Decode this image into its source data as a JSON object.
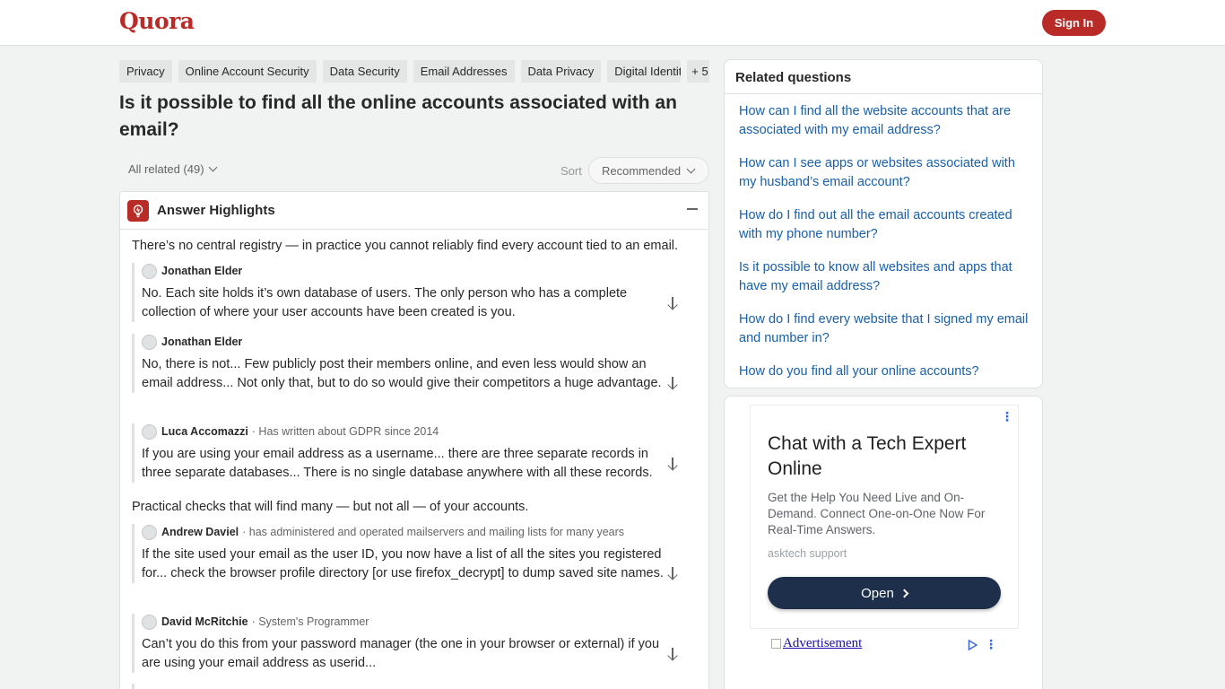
{
  "header": {
    "logo": "Quora",
    "sign_in": "Sign In"
  },
  "tags": [
    "Privacy",
    "Online Account Security",
    "Data Security",
    "Email Addresses",
    "Data Privacy",
    "Digital Identit",
    "+ 5"
  ],
  "question": {
    "title": "Is it possible to find all the online accounts associated with an email?"
  },
  "filters": {
    "all_related": "All related (49)",
    "sort_label": "Sort",
    "sort_value": "Recommended"
  },
  "highlights": {
    "title": "Answer Highlights",
    "sections": [
      {
        "summary": "There’s no central registry — in practice you cannot reliably find every account tied to an email.",
        "quotes": [
          {
            "author": "Jonathan Elder",
            "credential": "",
            "text": "No. Each site holds it’s own database of users. The only person who has a complete collection of where your user accounts have been created is you."
          },
          {
            "author": "Jonathan Elder",
            "credential": "",
            "text": "No, there is not... Few publicly post their members online, and even less would show an email address... Not only that, but to do so would give their competitors a huge advantage."
          },
          {
            "author": "Luca Accomazzi",
            "credential": "· Has written about GDPR since 2014",
            "text": "If you are using your email address as a username... there are three separate records in three separate databases... There is no single database anywhere with all these records."
          }
        ]
      },
      {
        "summary": "Practical checks that will find many — but not all — of your accounts.",
        "quotes": [
          {
            "author": "Andrew Daviel",
            "credential": "· has administered and operated mailservers and mailing lists for many years",
            "text": "If the site used your email as the user ID, you now have a list of all the sites you registered for... check the browser profile directory [or use firefox_decrypt] to dump saved site names."
          },
          {
            "author": "David McRitchie",
            "credential": "· System's Programmer",
            "text": "Can’t you do this from your password manager (the one in your browser or external) if you are using your email address as userid..."
          }
        ]
      }
    ]
  },
  "related": {
    "title": "Related questions",
    "items": [
      "How can I find all the website accounts that are associated with my email address?",
      "How can I see apps or websites associated with my husband’s email account?",
      "How do I find out all the email accounts created with my phone number?",
      "Is it possible to know all websites and apps that have my email address?",
      "How do I find every website that I signed my email and number in?",
      "How do you find all your online accounts?"
    ]
  },
  "ad": {
    "title": "Chat with a Tech Expert Online",
    "body": "Get the Help You Need Live and On-Demand. Connect One-on-One Now For Real-Time Answers.",
    "source": "asktech support",
    "cta": "Open",
    "alt_link": "Advertisement",
    "menu_glyph": "⋮"
  },
  "colors": {
    "brand": "#b92b27",
    "link": "#195faa",
    "ad_button": "#1d2f4a"
  }
}
